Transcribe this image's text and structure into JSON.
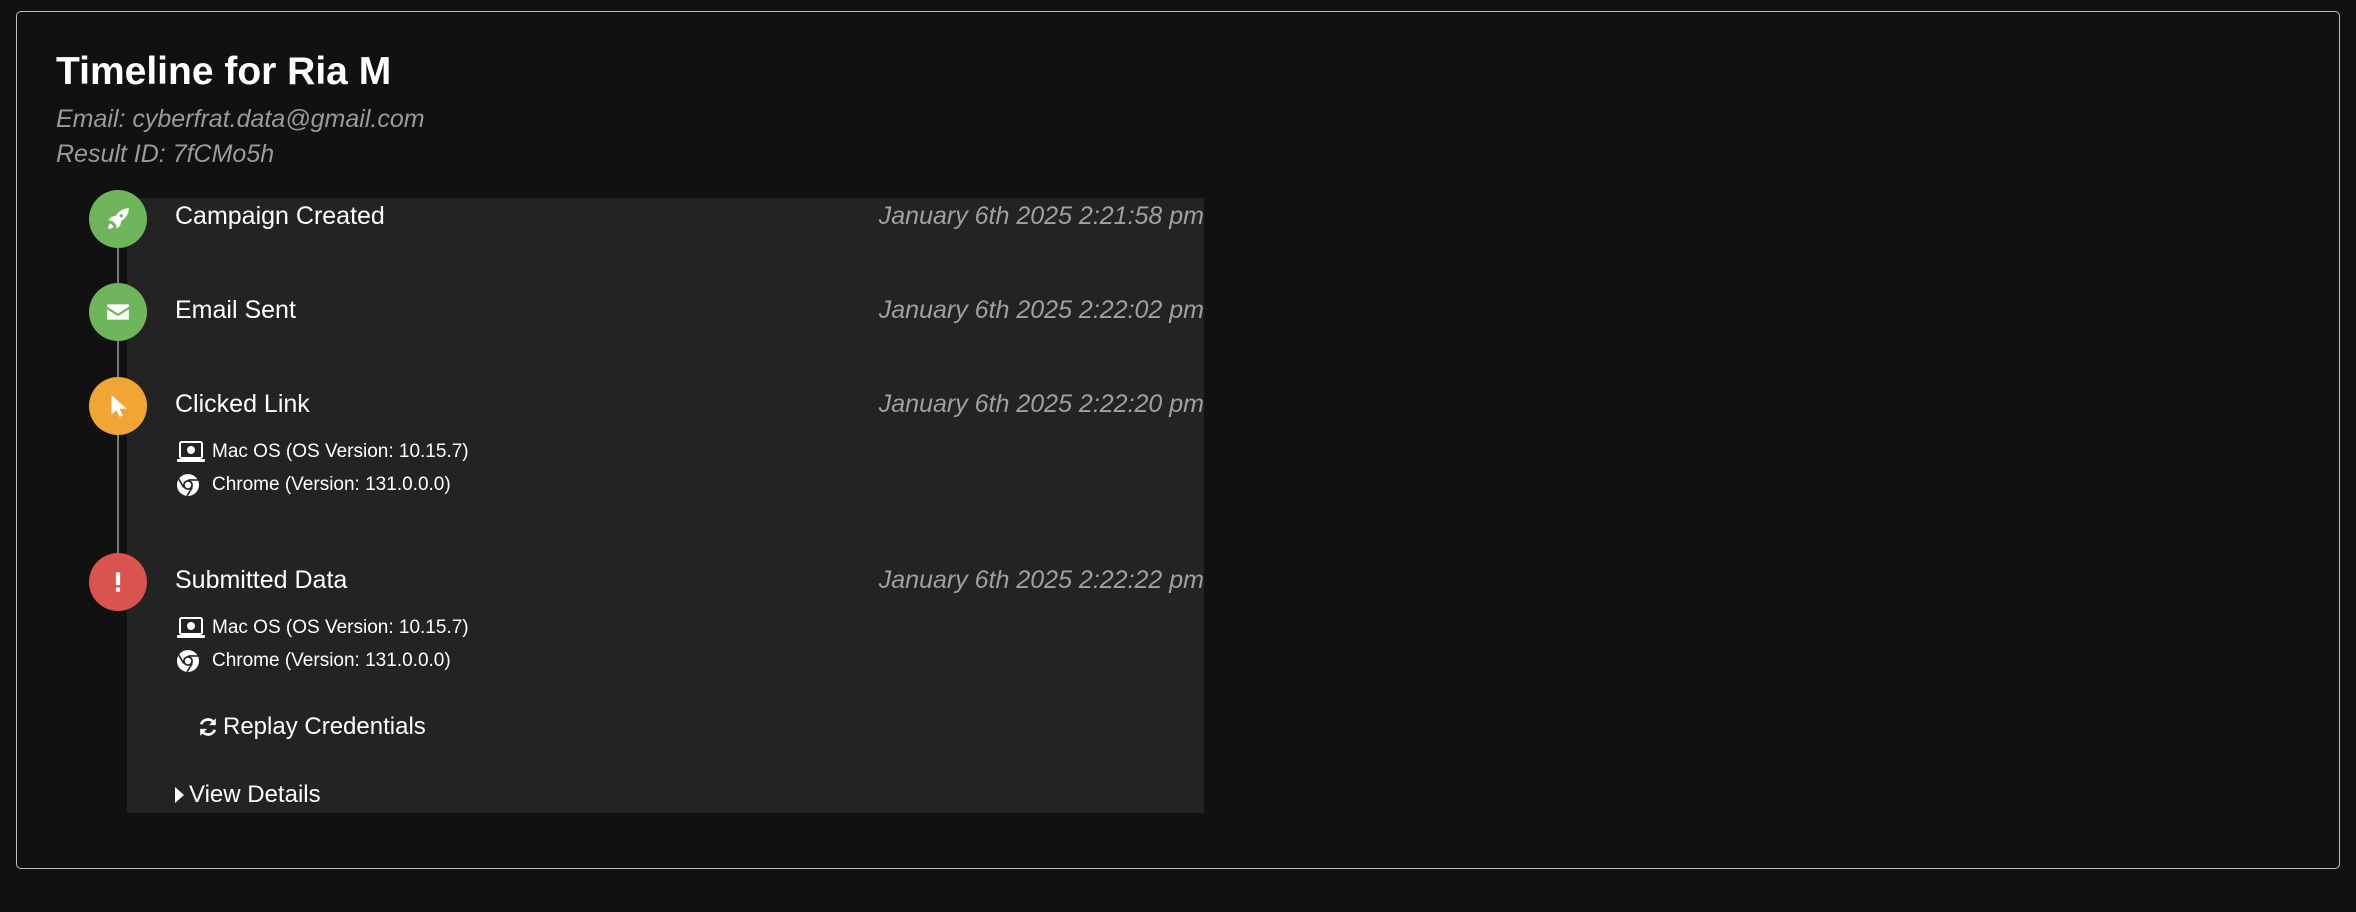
{
  "header": {
    "title": "Timeline for Ria M",
    "email": "Email: cyberfrat.data@gmail.com",
    "result_id": "Result ID: 7fCMo5h"
  },
  "events": [
    {
      "title": "Campaign Created",
      "time": "January 6th 2025 2:21:58 pm",
      "icon": "rocket-icon",
      "color": "#6fb55c"
    },
    {
      "title": "Email Sent",
      "time": "January 6th 2025 2:22:02 pm",
      "icon": "envelope-icon",
      "color": "#6fb55c"
    },
    {
      "title": "Clicked Link",
      "time": "January 6th 2025 2:22:20 pm",
      "icon": "mouse-pointer-icon",
      "color": "#f0a534",
      "os": "Mac OS (OS Version: 10.15.7)",
      "browser": "Chrome (Version: 131.0.0.0)"
    },
    {
      "title": "Submitted Data",
      "time": "January 6th 2025 2:22:22 pm",
      "icon": "exclamation-icon",
      "color": "#d9534f",
      "os": "Mac OS (OS Version: 10.15.7)",
      "browser": "Chrome (Version: 131.0.0.0)"
    }
  ],
  "actions": {
    "replay_label": "Replay Credentials",
    "view_details_label": "View Details"
  }
}
